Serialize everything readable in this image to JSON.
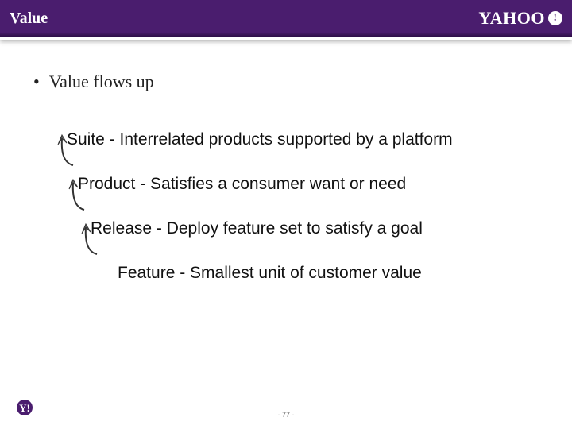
{
  "header": {
    "title": "Value",
    "logo_text": "YAHOO",
    "logo_bang": "!"
  },
  "main": {
    "bullet": "Value flows up",
    "rows": [
      "Suite - Interrelated products supported by a platform",
      "Product - Satisfies a consumer want or need",
      "Release - Deploy feature set to satisfy a goal",
      "Feature - Smallest unit of customer value"
    ]
  },
  "footer": {
    "page": "- 77 -"
  },
  "colors": {
    "brand": "#4a1d6e",
    "arrow_fill": "#6a6a6a",
    "arrow_stroke": "#333"
  }
}
